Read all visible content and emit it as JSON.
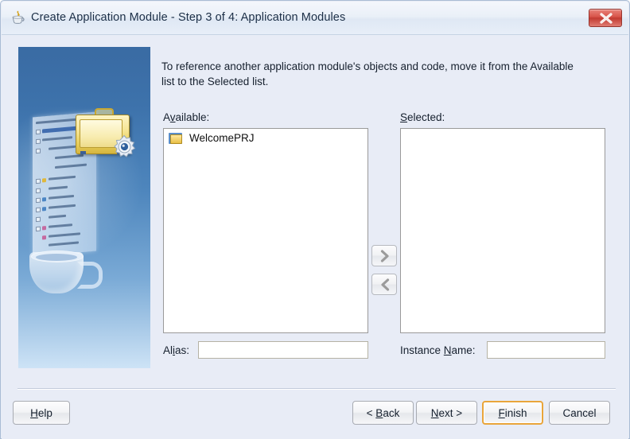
{
  "window": {
    "title": "Create Application Module - Step 3 of 4: Application Modules",
    "icon": "java-coffee-cup-icon",
    "close_label": "close-icon"
  },
  "content": {
    "intro_text": "To reference another application module's objects and code, move it from the Available list to the Selected list.",
    "available": {
      "label_before": "A",
      "label_mnemonic": "v",
      "label_after": "ailable:",
      "items": [
        {
          "label": "WelcomePRJ",
          "icon": "folder-icon"
        }
      ]
    },
    "selected": {
      "label_before": "",
      "label_mnemonic": "S",
      "label_after": "elected:",
      "items": []
    },
    "transfer": {
      "move_right": "❯",
      "move_left": "❮"
    },
    "alias": {
      "label_before": "Al",
      "label_mnemonic": "i",
      "label_after": "as:",
      "value": "",
      "placeholder": ""
    },
    "instance": {
      "label_before": "Instance ",
      "label_mnemonic": "N",
      "label_after": "ame:",
      "value": "",
      "placeholder": ""
    }
  },
  "footer": {
    "help": {
      "before": "",
      "mnemonic": "H",
      "after": "elp"
    },
    "back": {
      "before": "< ",
      "mnemonic": "B",
      "after": "ack"
    },
    "next": {
      "before": "",
      "mnemonic": "N",
      "after": "ext >"
    },
    "finish": {
      "before": "",
      "mnemonic": "F",
      "after": "inish"
    },
    "cancel": {
      "before": "Cancel",
      "mnemonic": "",
      "after": ""
    }
  },
  "colors": {
    "dialog_background": "#e8ecf6",
    "title_bar": "#eaf0f8",
    "close_button": "#c23b32",
    "default_button_border": "#e9a53b",
    "graphic_panel_top": "#3a6ba3",
    "graphic_panel_bottom": "#cde3f6",
    "list_background": "#ffffff",
    "text": "#16202e"
  }
}
